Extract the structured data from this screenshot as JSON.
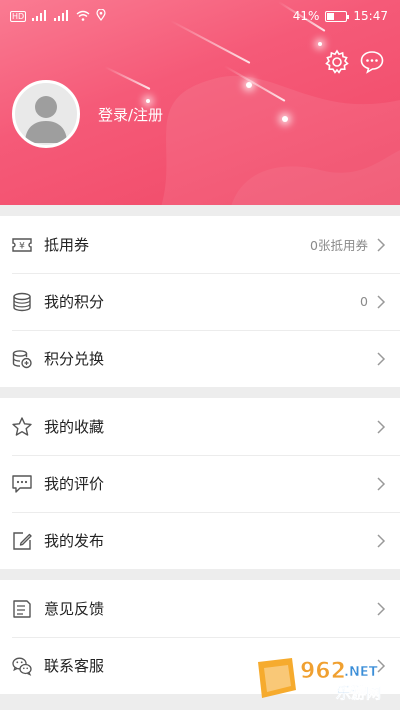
{
  "status_bar": {
    "left_badges": [
      "HD",
      "4G",
      "4G"
    ],
    "battery": "41%",
    "battery_level": 0.41,
    "time": "15:47"
  },
  "header": {
    "login_text": "登录/注册",
    "icons": [
      "settings-icon",
      "message-icon"
    ]
  },
  "menu_groups": [
    [
      {
        "icon": "voucher-icon",
        "label": "抵用券",
        "value": "0张抵用券"
      },
      {
        "icon": "coins-icon",
        "label": "我的积分",
        "value": "0"
      },
      {
        "icon": "exchange-icon",
        "label": "积分兑换",
        "value": ""
      }
    ],
    [
      {
        "icon": "star-icon",
        "label": "我的收藏",
        "value": ""
      },
      {
        "icon": "review-icon",
        "label": "我的评价",
        "value": ""
      },
      {
        "icon": "edit-icon",
        "label": "我的发布",
        "value": ""
      }
    ],
    [
      {
        "icon": "feedback-icon",
        "label": "意见反馈",
        "value": ""
      },
      {
        "icon": "wechat-icon",
        "label": "联系客服",
        "value": ""
      }
    ]
  ],
  "watermark": {
    "number": "962",
    "suffix": ".NET",
    "site": "乐游网"
  }
}
